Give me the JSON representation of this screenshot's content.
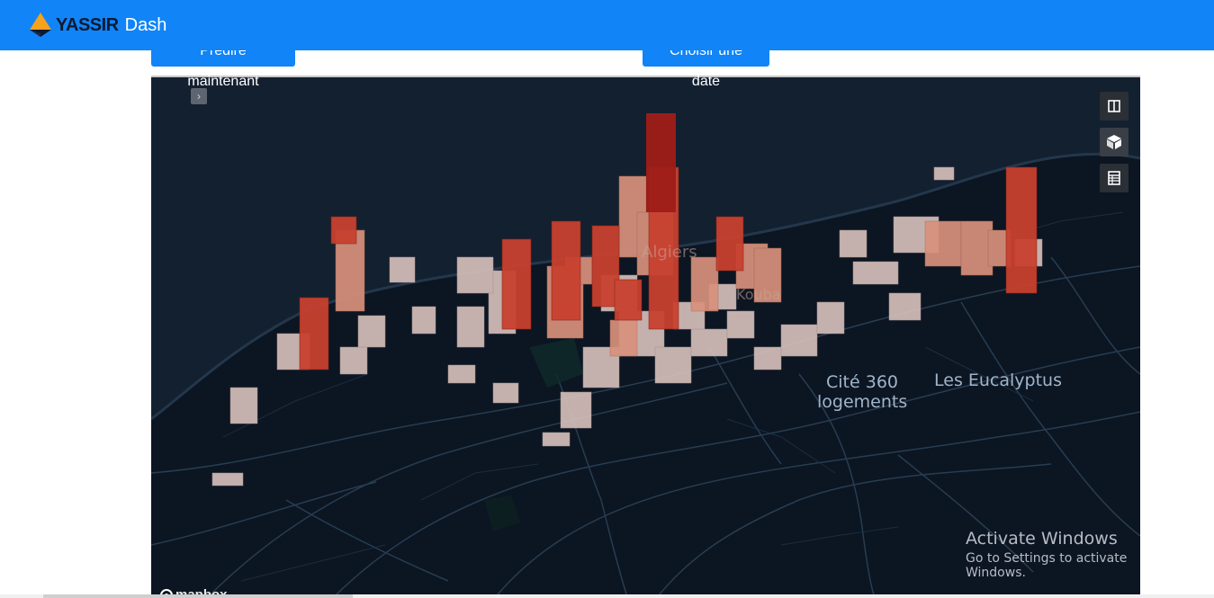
{
  "navbar": {
    "brand_name": "YASSIR",
    "app_name": "Dash",
    "background": "#1184f7"
  },
  "actions": {
    "predict_now_label": "Prédire maintenant",
    "choose_date_label": "Choisir une date"
  },
  "map": {
    "labels": {
      "city": "Algiers",
      "district": "Kouba",
      "cite_line1": "Cité 360",
      "cite_line2": "logements",
      "eucalyptus": "Les Eucalyptus"
    },
    "attribution": "mapbox",
    "controls": [
      "split-view-icon",
      "3d-cube-icon",
      "table-icon"
    ],
    "sidebar_toggle_icon": "chevron-right-icon",
    "colors": {
      "background": "#0d1827",
      "low": "#e2c9c3",
      "high": "#b3261e"
    }
  },
  "overlay": {
    "activate_title": "Activate Windows",
    "activate_sub": "Go to Settings to activate Windows."
  }
}
